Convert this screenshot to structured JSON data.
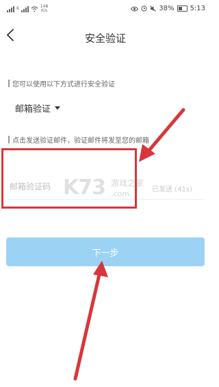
{
  "status_bar": {
    "left_tag_1": "6",
    "speed_value": "148",
    "speed_unit": "K/s",
    "battery": "38%",
    "time": "5:13"
  },
  "header": {
    "title": "安全验证"
  },
  "section1": {
    "label": "您可以使用以下方式进行安全验证",
    "method_selected": "邮箱验证"
  },
  "section2": {
    "label": "点击发送验证邮件，验证邮件将发至您的邮箱"
  },
  "code_input": {
    "placeholder": "邮箱验证码",
    "resend_label": "已发送 (41s)"
  },
  "watermark": {
    "brand": "K73",
    "cn": "游戏之家",
    "domain": ".com"
  },
  "next_button": {
    "label": "下一步"
  },
  "colors": {
    "accent": "#9cd3f5",
    "highlight": "#d8363a"
  }
}
